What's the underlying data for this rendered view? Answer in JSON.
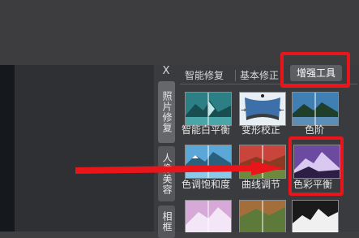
{
  "panel": {
    "close_label": "X",
    "side_tabs": [
      {
        "label": "照片修复"
      },
      {
        "label": "人像美容"
      },
      {
        "label": "相框"
      }
    ],
    "top_tabs": [
      {
        "label": "智能修复"
      },
      {
        "label": "基本修正"
      },
      {
        "label": "增强工具"
      }
    ],
    "active_tab": "增强工具",
    "tools": [
      {
        "label": "智能白平衡"
      },
      {
        "label": "变形校正"
      },
      {
        "label": "色阶"
      },
      {
        "label": "色调饱和度"
      },
      {
        "label": "曲线调节"
      },
      {
        "label": "色彩平衡"
      }
    ]
  },
  "colors": {
    "highlight": "#e8151b",
    "background": "#3a3b3e"
  }
}
